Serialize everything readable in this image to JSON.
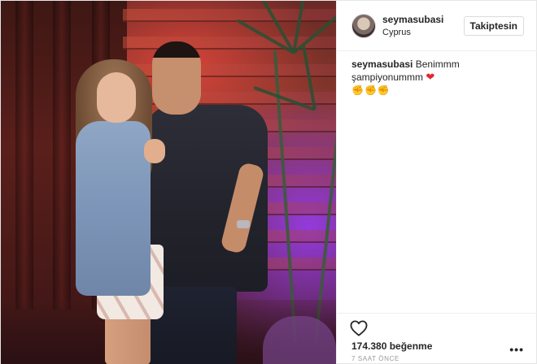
{
  "post": {
    "username": "seymasubasi",
    "location": "Cyprus",
    "follow_label": "Takiptesin",
    "caption": {
      "username": "seymasubasi",
      "text": "Benimmm şampiyonummm",
      "heart_icon": "red-heart-emoji",
      "hands_icon": "clapping-hands-emoji"
    },
    "likes": "174.380 beğenme",
    "time": "7 SAAT ÖNCE",
    "icons": {
      "like": "heart-outline-icon",
      "more": "more-options-icon"
    }
  },
  "colors": {
    "text": "#262626",
    "muted": "#999999",
    "border": "#efefef",
    "heart": "#e0272d"
  }
}
